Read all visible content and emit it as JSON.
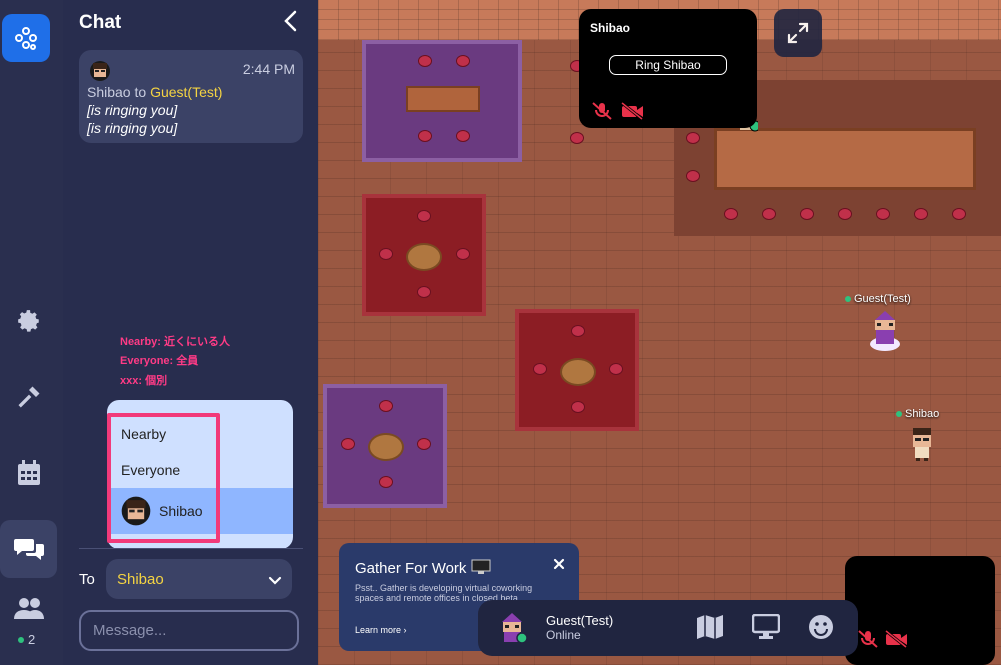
{
  "panel": {
    "title": "Chat"
  },
  "message": {
    "time": "2:44 PM",
    "sender": "Shibao",
    "to_word": "to",
    "recipient": "Guest(Test)",
    "lines": [
      "[is ringing you]",
      "[is ringing you]"
    ]
  },
  "notes": [
    "Nearby: 近くにいる人",
    "Everyone: 全員",
    "xxx: 個別"
  ],
  "dropdown": {
    "items": [
      "Nearby",
      "Everyone",
      "Shibao"
    ],
    "selected": "Shibao"
  },
  "composer": {
    "to_label": "To",
    "to_value": "Shibao",
    "placeholder": "Message..."
  },
  "rail": {
    "online_count": "2",
    "icons": [
      "gather-logo-icon",
      "gear-icon",
      "hammer-icon",
      "calendar-icon",
      "chat-icon",
      "people-icon"
    ]
  },
  "video": {
    "name": "Shibao",
    "ring_button": "Ring Shibao"
  },
  "players": [
    {
      "name": "Guest(Test)"
    },
    {
      "name": "Shibao"
    }
  ],
  "promo": {
    "title": "Gather For Work",
    "body": "Psst.. Gather is developing virtual coworking spaces and remote offices in closed beta.",
    "link": "Learn more ›"
  },
  "bar": {
    "name": "Guest(Test)",
    "status": "Online"
  },
  "colors": {
    "accent": "#1f6fe8",
    "highlight": "#f23a7a",
    "online": "#2ec27e",
    "recipient": "#f5d442"
  }
}
